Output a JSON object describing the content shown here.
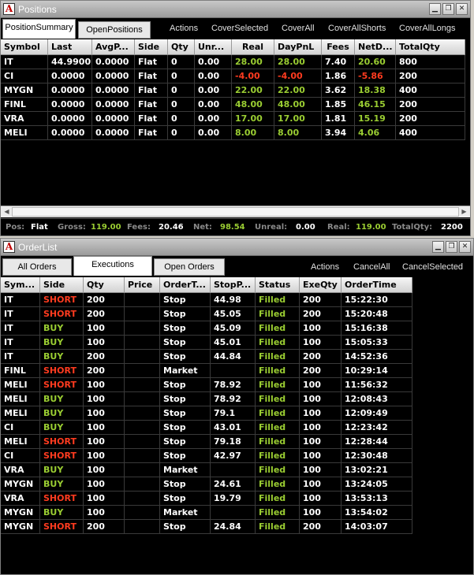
{
  "positions": {
    "title": "Positions",
    "tabs": [
      "PositionSummary",
      "OpenPositions"
    ],
    "actions": [
      "Actions",
      "CoverSelected",
      "CoverAll",
      "CoverAllShorts",
      "CoverAllLongs"
    ],
    "columns": [
      "Symbol",
      "Last",
      "AvgP...",
      "Side",
      "Qty",
      "Unr...",
      "Real",
      "DayPnL",
      "Fees",
      "NetD...",
      "TotalQty"
    ],
    "rows": [
      [
        "IT",
        "44.9900",
        "0.0000",
        "Flat",
        "0",
        "0.00",
        "28.00",
        "28.00",
        "7.40",
        "20.60",
        "800"
      ],
      [
        "CI",
        "0.0000",
        "0.0000",
        "Flat",
        "0",
        "0.00",
        "-4.00",
        "-4.00",
        "1.86",
        "-5.86",
        "200"
      ],
      [
        "MYGN",
        "0.0000",
        "0.0000",
        "Flat",
        "0",
        "0.00",
        "22.00",
        "22.00",
        "3.62",
        "18.38",
        "400"
      ],
      [
        "FINL",
        "0.0000",
        "0.0000",
        "Flat",
        "0",
        "0.00",
        "48.00",
        "48.00",
        "1.85",
        "46.15",
        "200"
      ],
      [
        "VRA",
        "0.0000",
        "0.0000",
        "Flat",
        "0",
        "0.00",
        "17.00",
        "17.00",
        "1.81",
        "15.19",
        "200"
      ],
      [
        "MELI",
        "0.0000",
        "0.0000",
        "Flat",
        "0",
        "0.00",
        "8.00",
        "8.00",
        "3.94",
        "4.06",
        "400"
      ]
    ],
    "status": {
      "pos_label": "Pos:",
      "pos": "Flat",
      "gross_label": "Gross:",
      "gross": "119.00",
      "fees_label": "Fees:",
      "fees": "20.46",
      "net_label": "Net:",
      "net": "98.54",
      "unreal_label": "Unreal:",
      "unreal": "0.00",
      "real_label": "Real:",
      "real": "119.00",
      "totalqty_label": "TotalQty:",
      "totalqty": "2200"
    }
  },
  "orderlist": {
    "title": "OrderList",
    "tabs": [
      "All Orders",
      "Executions",
      "Open Orders"
    ],
    "actions": [
      "Actions",
      "CancelAll",
      "CancelSelected"
    ],
    "columns": [
      "Sym...",
      "Side",
      "Qty",
      "Price",
      "OrderT...",
      "StopP...",
      "Status",
      "ExeQty",
      "OrderTime"
    ],
    "rows": [
      [
        "IT",
        "SHORT",
        "200",
        "",
        "Stop",
        "44.98",
        "Filled",
        "200",
        "15:22:30"
      ],
      [
        "IT",
        "SHORT",
        "200",
        "",
        "Stop",
        "45.05",
        "Filled",
        "200",
        "15:20:48"
      ],
      [
        "IT",
        "BUY",
        "100",
        "",
        "Stop",
        "45.09",
        "Filled",
        "100",
        "15:16:38"
      ],
      [
        "IT",
        "BUY",
        "100",
        "",
        "Stop",
        "45.01",
        "Filled",
        "100",
        "15:05:33"
      ],
      [
        "IT",
        "BUY",
        "200",
        "",
        "Stop",
        "44.84",
        "Filled",
        "200",
        "14:52:36"
      ],
      [
        "FINL",
        "SHORT",
        "200",
        "",
        "Market",
        "",
        "Filled",
        "200",
        "10:29:14"
      ],
      [
        "MELI",
        "SHORT",
        "100",
        "",
        "Stop",
        "78.92",
        "Filled",
        "100",
        "11:56:32"
      ],
      [
        "MELI",
        "BUY",
        "100",
        "",
        "Stop",
        "78.92",
        "Filled",
        "100",
        "12:08:43"
      ],
      [
        "MELI",
        "BUY",
        "100",
        "",
        "Stop",
        "79.1",
        "Filled",
        "100",
        "12:09:49"
      ],
      [
        "CI",
        "BUY",
        "100",
        "",
        "Stop",
        "43.01",
        "Filled",
        "100",
        "12:23:42"
      ],
      [
        "MELI",
        "SHORT",
        "100",
        "",
        "Stop",
        "79.18",
        "Filled",
        "100",
        "12:28:44"
      ],
      [
        "CI",
        "SHORT",
        "100",
        "",
        "Stop",
        "42.97",
        "Filled",
        "100",
        "12:30:48"
      ],
      [
        "VRA",
        "BUY",
        "100",
        "",
        "Market",
        "",
        "Filled",
        "100",
        "13:02:21"
      ],
      [
        "MYGN",
        "BUY",
        "100",
        "",
        "Stop",
        "24.61",
        "Filled",
        "100",
        "13:24:05"
      ],
      [
        "VRA",
        "SHORT",
        "100",
        "",
        "Stop",
        "19.79",
        "Filled",
        "100",
        "13:53:13"
      ],
      [
        "MYGN",
        "BUY",
        "100",
        "",
        "Market",
        "",
        "Filled",
        "100",
        "13:54:02"
      ],
      [
        "MYGN",
        "SHORT",
        "200",
        "",
        "Stop",
        "24.84",
        "Filled",
        "200",
        "14:03:07"
      ]
    ]
  },
  "colors": {
    "positive": "#9acd32",
    "negative": "#ff3b1f",
    "background": "#000000"
  }
}
